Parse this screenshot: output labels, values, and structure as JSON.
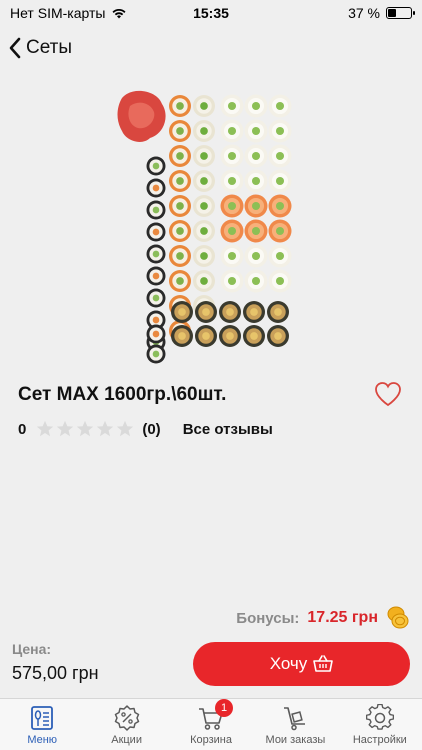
{
  "status_bar": {
    "carrier": "Нет SIM-карты",
    "time": "15:35",
    "battery": "37 %",
    "battery_level": 0.37
  },
  "nav": {
    "back_label": "Сеты"
  },
  "product": {
    "title": "Сет MAX 1600гр.\\60шт.",
    "rating": "0",
    "rating_stars": 0,
    "reviews_count": "(0)",
    "reviews_link": "Все отзывы"
  },
  "bonus": {
    "label": "Бонусы:",
    "value": "17.25 грн"
  },
  "price": {
    "label": "Цена:",
    "value": "575,00 грн"
  },
  "buy_button": {
    "label": "Хочу"
  },
  "tabs": [
    {
      "label": "Меню",
      "icon": "menu-book-icon",
      "active": true
    },
    {
      "label": "Акции",
      "icon": "discount-badge-icon",
      "active": false
    },
    {
      "label": "Корзина",
      "icon": "cart-icon",
      "active": false,
      "badge": "1"
    },
    {
      "label": "Мои заказы",
      "icon": "delivery-cart-icon",
      "active": false
    },
    {
      "label": "Настройки",
      "icon": "gear-icon",
      "active": false
    }
  ],
  "colors": {
    "accent": "#e8262a",
    "active_tab": "#2c5fb7",
    "bonus_value": "#d9262b",
    "background": "#efefef"
  }
}
